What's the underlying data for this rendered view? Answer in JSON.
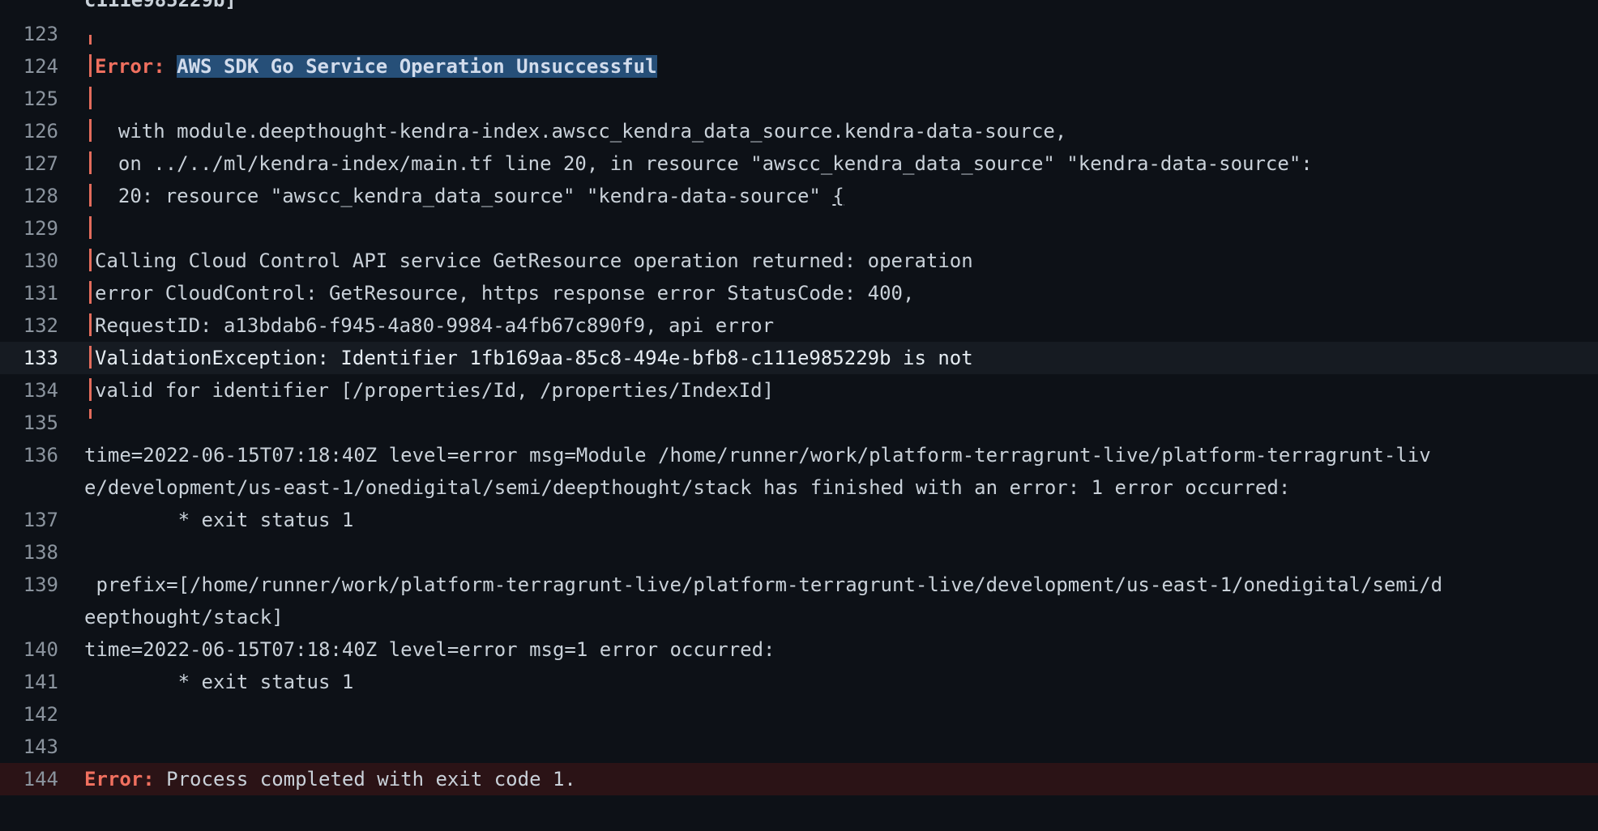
{
  "top_fragment": "c111e985229b]",
  "lines": [
    {
      "n": "123",
      "text": ""
    },
    {
      "n": "124",
      "label": "Error:",
      "selected": "AWS SDK Go Service Operation Unsuccessful"
    },
    {
      "n": "125",
      "text": ""
    },
    {
      "n": "126",
      "text": "  with module.deepthought-kendra-index.awscc_kendra_data_source.kendra-data-source,"
    },
    {
      "n": "127",
      "text": "  on ../../ml/kendra-index/main.tf line 20, in resource \"awscc_kendra_data_source\" \"kendra-data-source\":"
    },
    {
      "n": "128",
      "text_before": "  20: resource \"awscc_kendra_data_source\" \"kendra-data-source\" ",
      "brace": "{"
    },
    {
      "n": "129",
      "text": ""
    },
    {
      "n": "130",
      "text": "Calling Cloud Control API service GetResource operation returned: operation"
    },
    {
      "n": "131",
      "text": "error CloudControl: GetResource, https response error StatusCode: 400,"
    },
    {
      "n": "132",
      "text": "RequestID: a13bdab6-f945-4a80-9984-a4fb67c890f9, api error"
    },
    {
      "n": "133",
      "text": "ValidationException: Identifier 1fb169aa-85c8-494e-bfb8-c111e985229b is not"
    },
    {
      "n": "134",
      "text": "valid for identifier [/properties/Id, /properties/IndexId]"
    },
    {
      "n": "135",
      "text": ""
    },
    {
      "n": "136",
      "text": "time=2022-06-15T07:18:40Z level=error msg=Module /home/runner/work/platform-terragrunt-live/platform-terragrunt-live/development/us-east-1/onedigital/semi/deepthought/stack has finished with an error: 1 error occurred:"
    },
    {
      "n": "137",
      "text": "\t* exit status 1"
    },
    {
      "n": "138",
      "text": ""
    },
    {
      "n": "139",
      "text": " prefix=[/home/runner/work/platform-terragrunt-live/platform-terragrunt-live/development/us-east-1/onedigital/semi/deepthought/stack]"
    },
    {
      "n": "140",
      "text": "time=2022-06-15T07:18:40Z level=error msg=1 error occurred:"
    },
    {
      "n": "141",
      "text": "\t* exit status 1"
    },
    {
      "n": "142",
      "text": ""
    },
    {
      "n": "143",
      "text": ""
    },
    {
      "n": "144",
      "label": "Error:",
      "text": " Process completed with exit code 1."
    }
  ]
}
